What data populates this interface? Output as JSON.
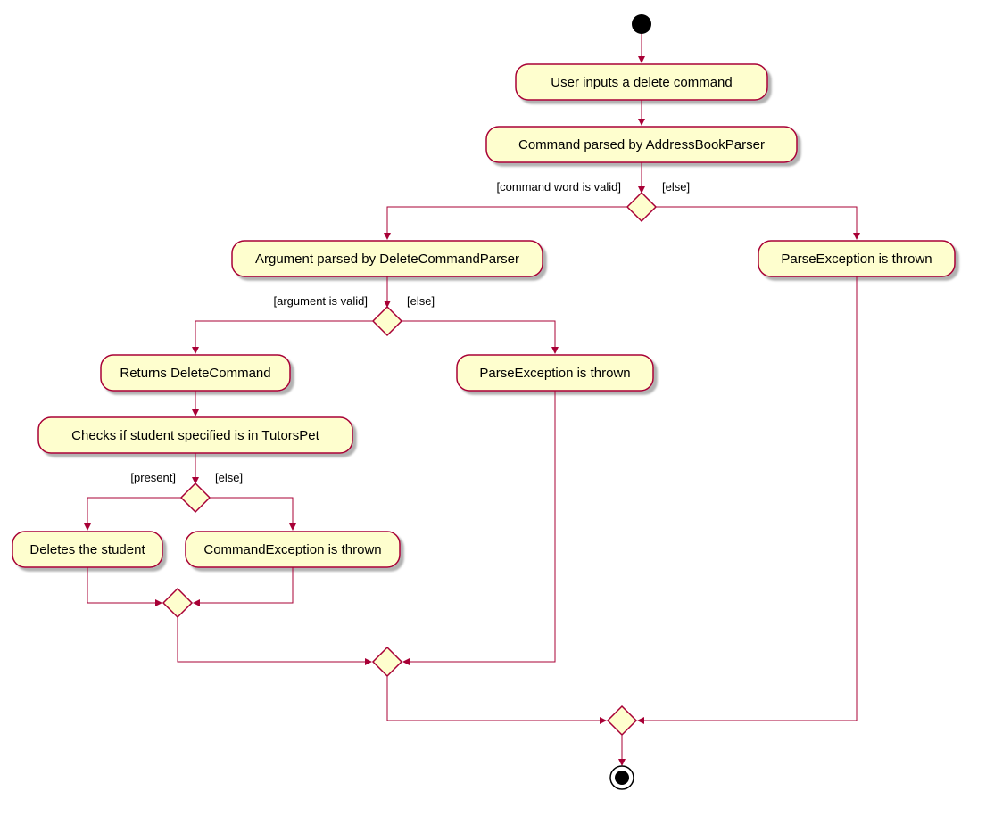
{
  "chart_data": {
    "type": "activity_diagram",
    "nodes": {
      "start": {
        "kind": "initial"
      },
      "a1": {
        "kind": "activity",
        "label": "User inputs a delete command"
      },
      "a2": {
        "kind": "activity",
        "label": "Command parsed by AddressBookParser"
      },
      "d1": {
        "kind": "decision",
        "guards": [
          "[command word is valid]",
          "[else]"
        ]
      },
      "a3": {
        "kind": "activity",
        "label": "Argument parsed by DeleteCommandParser"
      },
      "a4": {
        "kind": "activity",
        "label": "ParseException is thrown"
      },
      "d2": {
        "kind": "decision",
        "guards": [
          "[argument is valid]",
          "[else]"
        ]
      },
      "a5": {
        "kind": "activity",
        "label": "Returns DeleteCommand"
      },
      "a6": {
        "kind": "activity",
        "label": "ParseException is thrown"
      },
      "a7": {
        "kind": "activity",
        "label": "Checks if student specified is in TutorsPet"
      },
      "d3": {
        "kind": "decision",
        "guards": [
          "[present]",
          "[else]"
        ]
      },
      "a8": {
        "kind": "activity",
        "label": "Deletes the student"
      },
      "a9": {
        "kind": "activity",
        "label": "CommandException is thrown"
      },
      "m3": {
        "kind": "merge"
      },
      "m2": {
        "kind": "merge"
      },
      "m1": {
        "kind": "merge"
      },
      "end": {
        "kind": "final"
      }
    },
    "edges": [
      [
        "start",
        "a1"
      ],
      [
        "a1",
        "a2"
      ],
      [
        "a2",
        "d1"
      ],
      [
        "d1",
        "a3",
        "[command word is valid]"
      ],
      [
        "d1",
        "a4",
        "[else]"
      ],
      [
        "a3",
        "d2"
      ],
      [
        "d2",
        "a5",
        "[argument is valid]"
      ],
      [
        "d2",
        "a6",
        "[else]"
      ],
      [
        "a5",
        "a7"
      ],
      [
        "a7",
        "d3"
      ],
      [
        "d3",
        "a8",
        "[present]"
      ],
      [
        "d3",
        "a9",
        "[else]"
      ],
      [
        "a8",
        "m3"
      ],
      [
        "a9",
        "m3"
      ],
      [
        "m3",
        "m2"
      ],
      [
        "a6",
        "m2"
      ],
      [
        "m2",
        "m1"
      ],
      [
        "a4",
        "m1"
      ],
      [
        "m1",
        "end"
      ]
    ]
  },
  "nodes": {
    "a1": "User inputs a delete command",
    "a2": "Command parsed by AddressBookParser",
    "a3": "Argument parsed by DeleteCommandParser",
    "a4": "ParseException is thrown",
    "a5": "Returns DeleteCommand",
    "a6": "ParseException is thrown",
    "a7": "Checks if student specified is in TutorsPet",
    "a8": "Deletes the student",
    "a9": "CommandException is thrown"
  },
  "guards": {
    "d1_left": "[command word is valid]",
    "d1_right": "[else]",
    "d2_left": "[argument is valid]",
    "d2_right": "[else]",
    "d3_left": "[present]",
    "d3_right": "[else]"
  }
}
